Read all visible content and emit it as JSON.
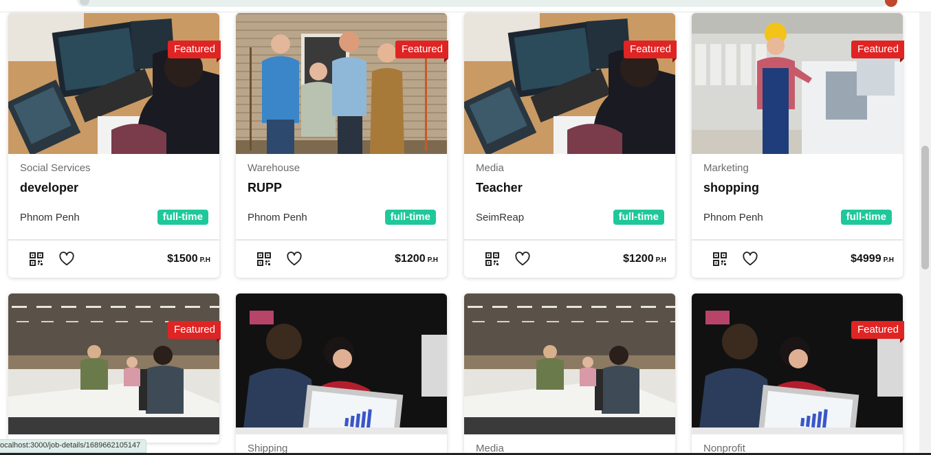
{
  "browser": {
    "status_url": "ocalhost:3000/job-details/1689662105147"
  },
  "jobs": [
    {
      "category": "Social Services",
      "title": "developer",
      "location": "Phnom Penh",
      "type": "full-time",
      "price": "$1500",
      "unit": "P.H",
      "featured": "Featured",
      "photo": "office-coding"
    },
    {
      "category": "Warehouse",
      "title": "RUPP",
      "location": "Phnom Penh",
      "type": "full-time",
      "price": "$1200",
      "unit": "P.H",
      "featured": "Featured",
      "photo": "farm-team"
    },
    {
      "category": "Media",
      "title": "Teacher",
      "location": "SeimReap",
      "type": "full-time",
      "price": "$1200",
      "unit": "P.H",
      "featured": "Featured",
      "photo": "office-coding"
    },
    {
      "category": "Marketing",
      "title": "shopping",
      "location": "Phnom Penh",
      "type": "full-time",
      "price": "$4999",
      "unit": "P.H",
      "featured": "Featured",
      "photo": "factory-worker"
    },
    {
      "category": "",
      "title": "",
      "location": "",
      "type": "",
      "price": "",
      "unit": "",
      "featured": "Featured",
      "photo": "workshop"
    },
    {
      "category": "Shipping",
      "title": "",
      "location": "",
      "type": "",
      "price": "",
      "unit": "",
      "featured": "",
      "photo": "meeting"
    },
    {
      "category": "Media",
      "title": "",
      "location": "",
      "type": "",
      "price": "",
      "unit": "",
      "featured": "",
      "photo": "workshop"
    },
    {
      "category": "Nonprofit",
      "title": "",
      "location": "",
      "type": "",
      "price": "",
      "unit": "",
      "featured": "Featured",
      "photo": "meeting"
    }
  ],
  "icons": {
    "qr": "qr-code-icon",
    "heart": "heart-icon"
  },
  "colors": {
    "featured": "#e02424",
    "job_type": "#1fc89a"
  }
}
